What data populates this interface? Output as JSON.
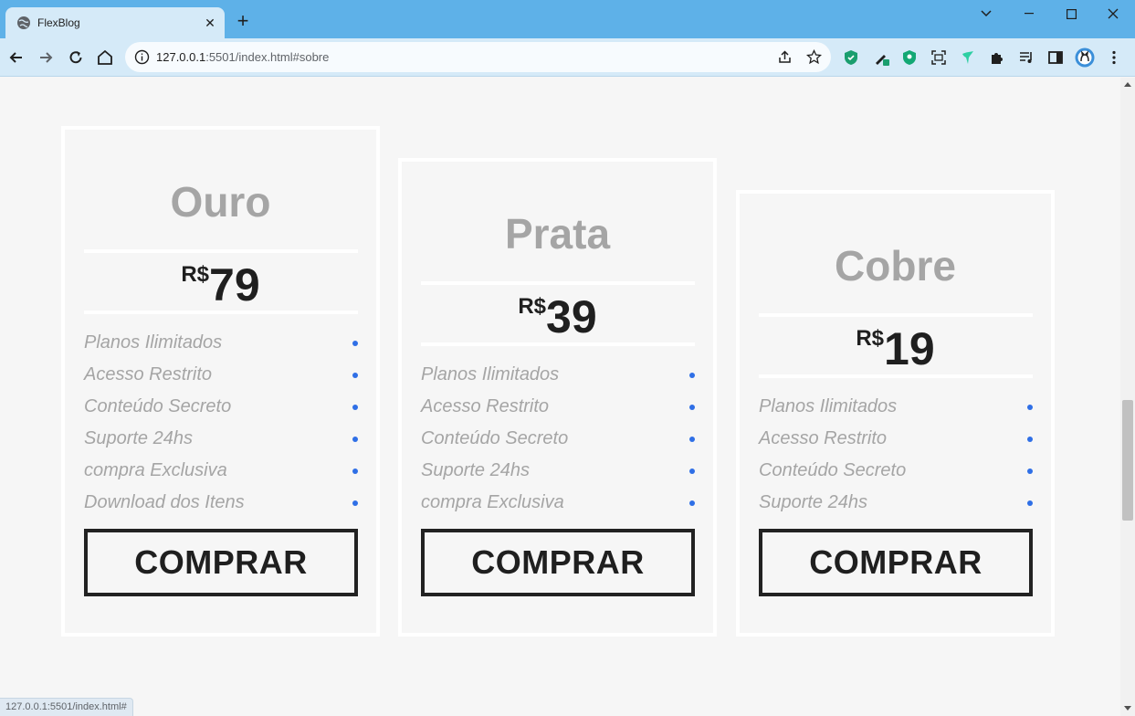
{
  "browser": {
    "tab_title": "FlexBlog",
    "tab_close": "✕",
    "new_tab": "+",
    "url_host": "127.0.0.1",
    "url_path": ":5501/index.html#sobre",
    "window_controls": {
      "dropdown": "⌄",
      "minimize": "—",
      "maximize": "☐",
      "close": "✕"
    },
    "extensions": [
      "shield-icon",
      "pen-icon",
      "shield-icon",
      "capture-icon",
      "bird-icon",
      "puzzle-icon",
      "media-icon",
      "sidepanel-icon",
      "profile-icon",
      "menu-icon"
    ],
    "status_url": "127.0.0.1:5501/index.html#"
  },
  "pricing": {
    "cards": [
      {
        "name": "Ouro",
        "currency": "R$",
        "price": "79",
        "features": [
          "Planos Ilimitados",
          "Acesso Restrito",
          "Conteúdo Secreto",
          "Suporte 24hs",
          "compra Exclusiva",
          "Download dos Itens"
        ],
        "button": "COMPRAR"
      },
      {
        "name": "Prata",
        "currency": "R$",
        "price": "39",
        "features": [
          "Planos Ilimitados",
          "Acesso Restrito",
          "Conteúdo Secreto",
          "Suporte 24hs",
          "compra Exclusiva"
        ],
        "button": "COMPRAR"
      },
      {
        "name": "Cobre",
        "currency": "R$",
        "price": "19",
        "features": [
          "Planos Ilimitados",
          "Acesso Restrito",
          "Conteúdo Secreto",
          "Suporte 24hs"
        ],
        "button": "COMPRAR"
      }
    ]
  },
  "colors": {
    "titlebar": "#5eb1e8",
    "toolbar": "#d5eaf8",
    "page_bg": "#f6f6f6",
    "plan_name": "#a5a5a5",
    "feature_dot": "#2f6fe6",
    "button_border": "#222222"
  }
}
